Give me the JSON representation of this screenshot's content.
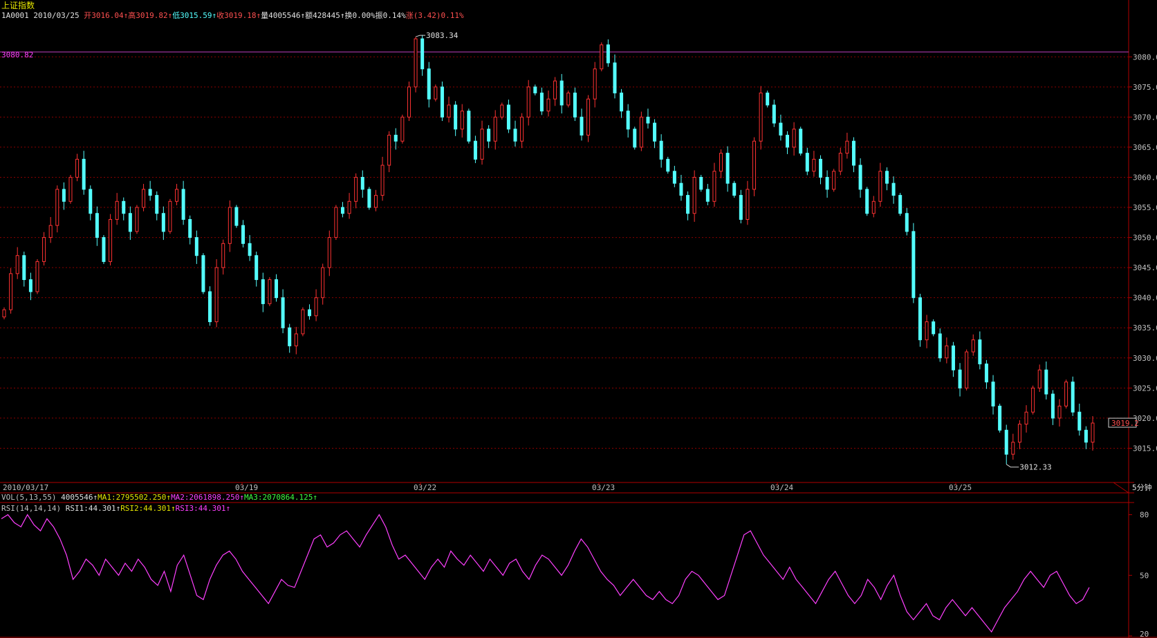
{
  "app": {
    "index_name": "上证指数",
    "code": "1A0001",
    "date": "2010/03/25",
    "period": "5分钟"
  },
  "quote": [
    {
      "label": "开",
      "value": "3016.04",
      "arrow": "↑",
      "color": "#ff5050"
    },
    {
      "label": "高",
      "value": "3019.82",
      "arrow": "↑",
      "color": "#ff5050"
    },
    {
      "label": "低",
      "value": "3015.59",
      "arrow": "↑",
      "color": "#54ffff"
    },
    {
      "label": "收",
      "value": "3019.18",
      "arrow": "↑",
      "color": "#ff5050"
    },
    {
      "label": "量",
      "value": "4005546",
      "arrow": "↑",
      "color": "#e0e0e0"
    },
    {
      "label": "额",
      "value": "428445",
      "arrow": "↑",
      "color": "#e0e0e0"
    },
    {
      "label": "换",
      "value": "0.00%",
      "arrow": "",
      "color": "#e0e0e0"
    },
    {
      "label": "振",
      "value": "0.14%",
      "arrow": "",
      "color": "#e0e0e0"
    },
    {
      "label": "涨",
      "value": "(3.42)0.11%",
      "arrow": "",
      "color": "#ff5050"
    }
  ],
  "price_panel": {
    "ref_line_label": "3080.82",
    "current_price_label": "3019.2",
    "high_marker": "3083.34",
    "low_marker": "3012.33"
  },
  "indicators": {
    "vol": [
      {
        "text": "VOL(5,13,55)",
        "color": "#c0c0c0"
      },
      {
        "text": " 4005546↑",
        "color": "#e0e0e0"
      },
      {
        "text": "MA1:2795502.250↑",
        "color": "#e6e600"
      },
      {
        "text": "MA2:2061898.250↑",
        "color": "#ff40ff"
      },
      {
        "text": "MA3:2070864.125↑",
        "color": "#40ff40"
      }
    ],
    "rsi": [
      {
        "text": "RSI(14,14,14)",
        "color": "#c0c0c0"
      },
      {
        "text": " RSI1:44.301↑",
        "color": "#e0e0e0"
      },
      {
        "text": "RSI2:44.301↑",
        "color": "#e6e600"
      },
      {
        "text": "RSI3:44.301↑",
        "color": "#ff40ff"
      }
    ],
    "rsi_axis_labels": [
      "80",
      "50",
      "20"
    ]
  },
  "colors": {
    "up": "#ff3232",
    "down": "#54ffff",
    "grid": "#8b0000",
    "frame": "#b00000",
    "ref_line": "#c040c0",
    "rsi_line": "#ff40ff"
  },
  "chart_data": [
    {
      "type": "candlestick",
      "title": "上证指数",
      "ylim": [
        3010,
        3086
      ],
      "y_ticks": [
        3015,
        3020,
        3025,
        3030,
        3035,
        3040,
        3045,
        3050,
        3055,
        3060,
        3065,
        3070,
        3075,
        3080
      ],
      "x_date_labels": [
        "2010/03/17",
        "03/19",
        "03/22",
        "03/23",
        "03/24",
        "03/25"
      ],
      "reference_line": 3080.82,
      "high": 3083.34,
      "low": 3012.33,
      "last_close": 3019.18,
      "close_series": [
        3038,
        3044,
        3047,
        3043,
        3041,
        3046,
        3050,
        3052,
        3058,
        3056,
        3060,
        3063,
        3058,
        3054,
        3050,
        3046,
        3053,
        3056,
        3054,
        3051,
        3055,
        3058,
        3057,
        3054,
        3051,
        3056,
        3058,
        3053,
        3050,
        3047,
        3041,
        3036,
        3045,
        3049,
        3055,
        3052,
        3049,
        3047,
        3043,
        3039,
        3043,
        3040,
        3035,
        3032,
        3034,
        3038,
        3037,
        3040,
        3045,
        3050,
        3055,
        3054,
        3056,
        3060,
        3058,
        3055,
        3057,
        3062,
        3067,
        3066,
        3070,
        3075,
        3083,
        3078,
        3073,
        3075,
        3070,
        3072,
        3068,
        3071,
        3066,
        3063,
        3068,
        3066,
        3070,
        3072,
        3068,
        3066,
        3070,
        3075,
        3074,
        3071,
        3073,
        3076,
        3072,
        3074,
        3070,
        3067,
        3073,
        3078,
        3082,
        3079,
        3074,
        3071,
        3068,
        3065,
        3070,
        3069,
        3066,
        3063,
        3061,
        3059,
        3057,
        3054,
        3060,
        3058,
        3056,
        3061,
        3064,
        3059,
        3057,
        3053,
        3058,
        3066,
        3074,
        3072,
        3069,
        3067,
        3065,
        3068,
        3064,
        3061,
        3063,
        3060,
        3058,
        3061,
        3064,
        3066,
        3062,
        3058,
        3054,
        3056,
        3061,
        3059,
        3057,
        3054,
        3051,
        3040,
        3033,
        3036,
        3034,
        3030,
        3032,
        3028,
        3025,
        3031,
        3033,
        3029,
        3026,
        3022,
        3018,
        3014,
        3016,
        3019,
        3021,
        3025,
        3028,
        3024,
        3020,
        3022,
        3026,
        3021,
        3018,
        3016,
        3019.18
      ],
      "rsi_ylim": [
        20,
        85
      ],
      "rsi_series": [
        78,
        80,
        76,
        74,
        80,
        75,
        72,
        78,
        74,
        68,
        60,
        48,
        52,
        58,
        55,
        50,
        58,
        54,
        50,
        56,
        52,
        58,
        54,
        48,
        45,
        52,
        42,
        55,
        60,
        50,
        40,
        38,
        48,
        55,
        60,
        62,
        58,
        52,
        48,
        44,
        40,
        36,
        42,
        48,
        45,
        44,
        52,
        60,
        68,
        70,
        64,
        66,
        70,
        72,
        68,
        64,
        70,
        75,
        80,
        74,
        65,
        58,
        60,
        56,
        52,
        48,
        54,
        58,
        54,
        62,
        58,
        55,
        60,
        56,
        52,
        58,
        54,
        50,
        56,
        58,
        52,
        48,
        55,
        60,
        58,
        54,
        50,
        55,
        62,
        68,
        64,
        58,
        52,
        48,
        45,
        40,
        44,
        48,
        44,
        40,
        38,
        42,
        38,
        36,
        40,
        48,
        52,
        50,
        46,
        42,
        38,
        40,
        50,
        60,
        70,
        72,
        66,
        60,
        56,
        52,
        48,
        54,
        48,
        44,
        40,
        36,
        42,
        48,
        52,
        46,
        40,
        36,
        40,
        48,
        44,
        38,
        45,
        50,
        40,
        32,
        28,
        32,
        36,
        30,
        28,
        34,
        38,
        34,
        30,
        34,
        30,
        26,
        22,
        28,
        34,
        38,
        42,
        48,
        52,
        48,
        44,
        50,
        52,
        46,
        40,
        36,
        38,
        44
      ]
    }
  ]
}
